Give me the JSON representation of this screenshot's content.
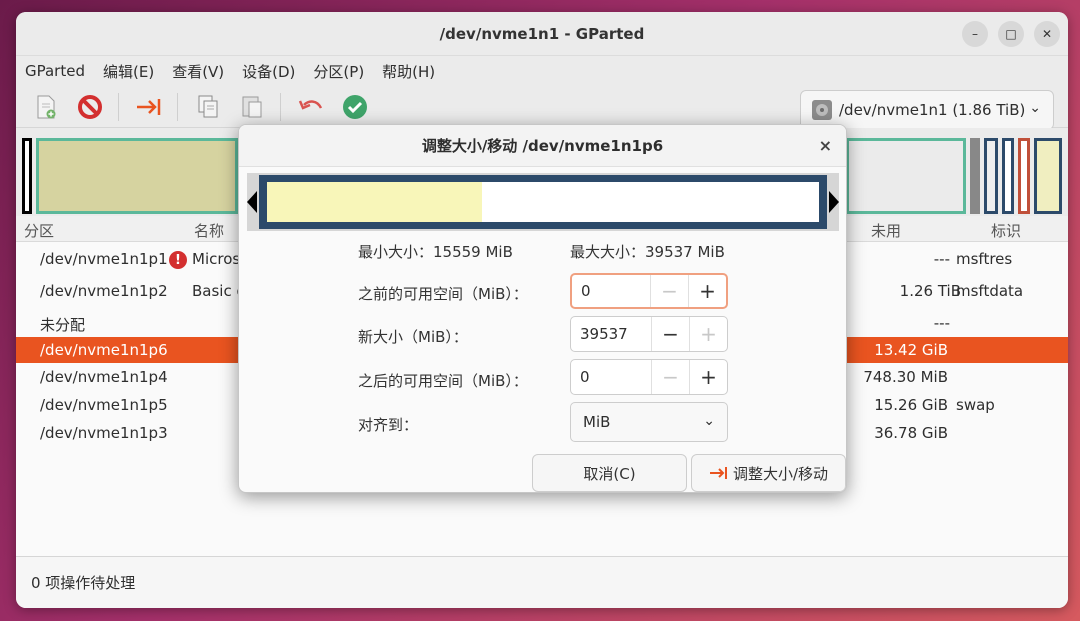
{
  "window": {
    "title": "/dev/nvme1n1 - GParted",
    "minimize": "–",
    "maximize": "□",
    "close": "✕"
  },
  "menu": [
    "GParted",
    "编辑(E)",
    "查看(V)",
    "设备(D)",
    "分区(P)",
    "帮助(H)"
  ],
  "toolbar": {
    "device": "/dev/nvme1n1 (1.86 TiB)"
  },
  "columns": {
    "partition": "分区",
    "name": "名称",
    "used": "未用",
    "flags": "标识"
  },
  "partitions": [
    {
      "partition": "/dev/nvme1n1p1",
      "name": "Micros",
      "unused": "---",
      "flags": "msftres",
      "warning": true
    },
    {
      "partition": "/dev/nvme1n1p2",
      "name": "Basic d",
      "unused": "1.26 TiB",
      "flags": "msftdata"
    },
    {
      "partition": "未分配",
      "name": "",
      "unused": "---",
      "flags": ""
    },
    {
      "partition": "/dev/nvme1n1p6",
      "name": "",
      "unused": "13.42 GiB",
      "flags": "",
      "selected": true
    },
    {
      "partition": "/dev/nvme1n1p4",
      "name": "",
      "unused": "748.30 MiB",
      "flags": ""
    },
    {
      "partition": "/dev/nvme1n1p5",
      "name": "",
      "unused": "15.26 GiB",
      "flags": "swap"
    },
    {
      "partition": "/dev/nvme1n1p3",
      "name": "",
      "unused": "36.78 GiB",
      "flags": ""
    }
  ],
  "status": "0 项操作待处理",
  "dialog": {
    "title": "调整大小/移动 /dev/nvme1n1p6",
    "close": "×",
    "min_size": "最小大小：15559 MiB",
    "max_size": "最大大小：39537 MiB",
    "space_before_label": "之前的可用空间（MiB）：",
    "space_before_value": "0",
    "new_size_label": "新大小（MiB）：",
    "new_size_value": "39537",
    "space_after_label": "之后的可用空间（MiB）：",
    "space_after_value": "0",
    "align_label": "对齐到：",
    "align_value": "MiB",
    "cancel": "取消(C)",
    "resize": "调整大小/移动",
    "used_fraction": 0.39
  },
  "colors": {
    "accent": "#e95420",
    "partition_frame": "#2c4a6a",
    "used_space": "#f8f6b9"
  }
}
